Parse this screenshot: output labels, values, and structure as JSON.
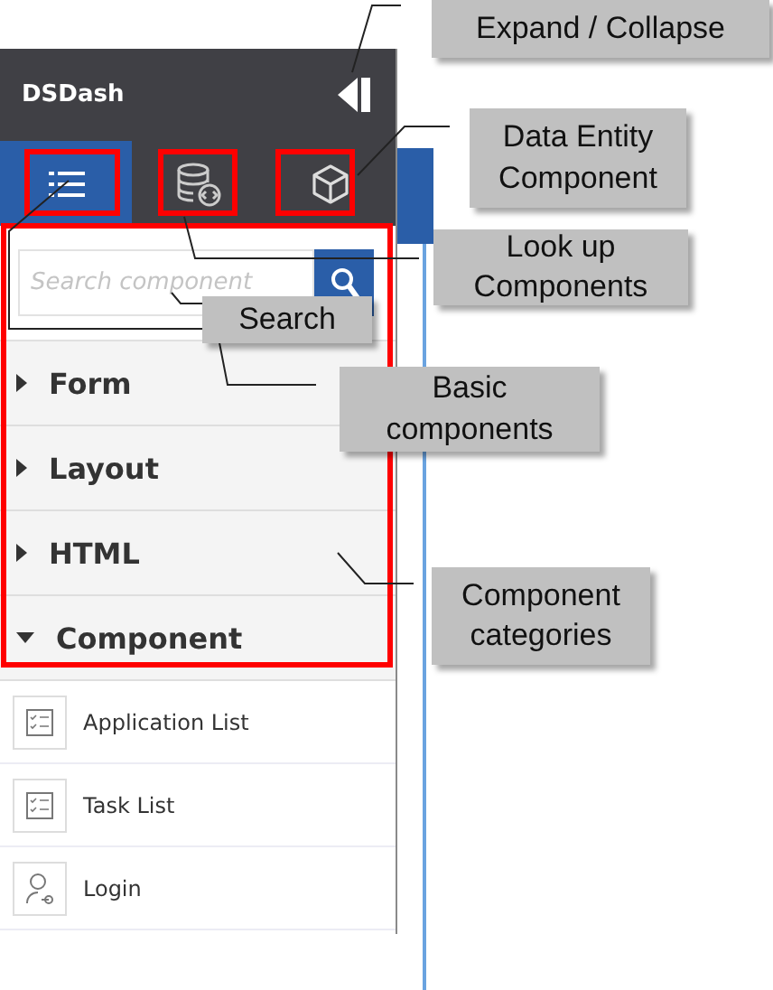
{
  "app": {
    "title": "DSDash"
  },
  "tabs": [
    {
      "kind": "list",
      "selected": true
    },
    {
      "kind": "database",
      "selected": false
    },
    {
      "kind": "cube",
      "selected": false
    }
  ],
  "search": {
    "placeholder": "Search component"
  },
  "categories": [
    {
      "label": "Form",
      "expanded": false
    },
    {
      "label": "Layout",
      "expanded": false
    },
    {
      "label": "HTML",
      "expanded": false
    },
    {
      "label": "Component",
      "expanded": true,
      "items": [
        {
          "label": "Application List",
          "kind": "checklist"
        },
        {
          "label": "Task List",
          "kind": "checklist"
        },
        {
          "label": "Login",
          "kind": "user"
        }
      ]
    }
  ],
  "callouts": [
    "Expand / Collapse",
    "Data Entity Component",
    "Look up Components",
    "Search",
    "Basic components",
    "Component categories"
  ]
}
